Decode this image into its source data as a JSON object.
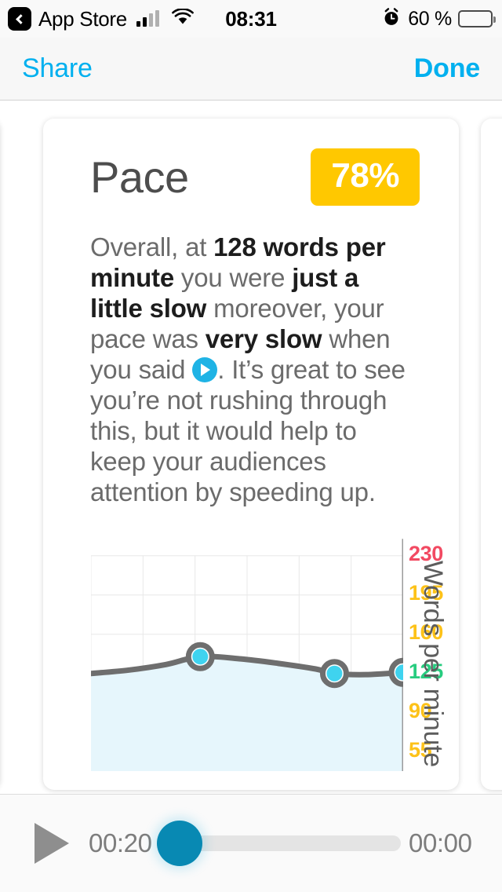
{
  "status_bar": {
    "back_label": "App Store",
    "back_icon": "back-chevron-icon",
    "signal_icon": "cellular-signal-icon",
    "wifi_icon": "wifi-icon",
    "time": "08:31",
    "alarm_icon": "alarm-clock-icon",
    "battery_percent": "60 %",
    "battery_icon": "battery-icon",
    "battery_level": 60
  },
  "nav_bar": {
    "share_label": "Share",
    "done_label": "Done",
    "accent_color": "#00b0ef"
  },
  "card": {
    "title": "Pace",
    "score": "78%",
    "score_color": "#ffc800",
    "body": {
      "segments": [
        {
          "text": "Overall, at ",
          "bold": false
        },
        {
          "text": "128 words per minute",
          "bold": true
        },
        {
          "text": " you were ",
          "bold": false
        },
        {
          "text": "just a little slow",
          "bold": true
        },
        {
          "text": " moreover, your pace was ",
          "bold": false
        },
        {
          "text": "very slow",
          "bold": true
        },
        {
          "text": " when you said ",
          "bold": false
        },
        {
          "text": "",
          "icon": "play-circle-icon"
        },
        {
          "text": ". It’s great to see you’re not rushing through this, but it would help to keep your audiences attention by speeding up.",
          "bold": false
        }
      ]
    }
  },
  "chart_data": {
    "type": "area",
    "title": "",
    "xlabel": "",
    "ylabel": "Words per minute",
    "ylim": [
      38,
      248
    ],
    "grid": true,
    "legend": null,
    "yticks": [
      {
        "value": 230,
        "label": "230",
        "color": "#f24a62"
      },
      {
        "value": 195,
        "label": "195",
        "color": "#fdc219"
      },
      {
        "value": 160,
        "label": "160",
        "color": "#fdc219"
      },
      {
        "value": 125,
        "label": "125",
        "color": "#27cc7f"
      },
      {
        "value": 90,
        "label": "90",
        "color": "#fdc219"
      },
      {
        "value": 55,
        "label": "55",
        "color": "#fdc219"
      }
    ],
    "line_color": "#6e6e6e",
    "fill_color": "#e6f6fc",
    "marker_color": "#3fd3ef",
    "marker_ring_color": "#6e6e6e",
    "x": [
      0,
      12,
      24,
      35,
      48,
      60,
      72,
      78,
      88,
      100
    ],
    "values": [
      125,
      128,
      133,
      140,
      138,
      134,
      129,
      125,
      124,
      126
    ],
    "markers": [
      {
        "x": 35,
        "y": 140
      },
      {
        "x": 78,
        "y": 125
      },
      {
        "x": 100,
        "y": 126
      }
    ]
  },
  "player": {
    "play_icon": "play-icon",
    "elapsed_time": "00:20",
    "remaining_time": "00:00",
    "progress_percent": 0,
    "thumb_color": "#0889b3",
    "track_color": "#e4e4e4"
  }
}
